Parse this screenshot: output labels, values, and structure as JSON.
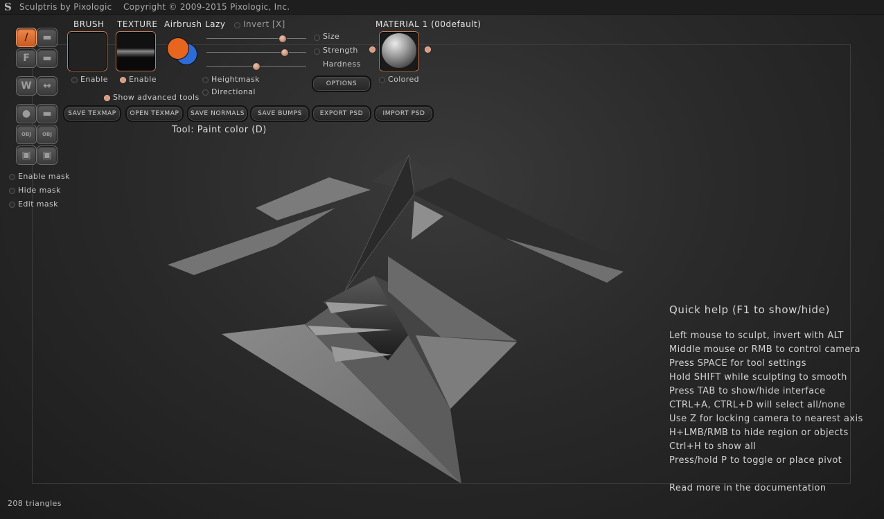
{
  "window": {
    "title": "Sculptris by Pixologic    Copyright © 2009-2015 Pixologic, Inc."
  },
  "palette": {
    "draw_glyph": "/",
    "flatten_glyph": "F",
    "pinch_glyph": "W",
    "symmetry_glyph": "↔",
    "obj_label": "OBJ"
  },
  "brush": {
    "header": "BRUSH",
    "enable_label": "Enable",
    "enabled": false
  },
  "texture": {
    "header": "TEXTURE",
    "enable_label": "Enable",
    "enabled": true
  },
  "airbrush": {
    "header": "Airbrush",
    "primary_color": "#e8651f",
    "secondary_color": "#2d6bd6"
  },
  "lazy": {
    "header": "Lazy"
  },
  "invert": {
    "label": "Invert [X]",
    "enabled": false
  },
  "sliders": [
    {
      "label": "Size",
      "value": 0.76
    },
    {
      "label": "Strength",
      "value": 0.78
    },
    {
      "label": "Hardness",
      "value": 0.49
    }
  ],
  "options": {
    "heightmask": "Heightmask",
    "directional": "Directional",
    "show_advanced": "Show advanced tools",
    "options_button": "OPTIONS"
  },
  "material": {
    "header": "MATERIAL 1 (00default)",
    "colored_label": "Colored"
  },
  "export_buttons": [
    "SAVE TEXMAP",
    "OPEN TEXMAP",
    "SAVE NORMALS",
    "SAVE BUMPS",
    "EXPORT PSD",
    "IMPORT PSD"
  ],
  "tool_status": "Tool: Paint color (D)",
  "mask": {
    "enable": "Enable mask",
    "hide": "Hide mask",
    "edit": "Edit mask"
  },
  "quick_help": {
    "title": "Quick help (F1 to show/hide)",
    "lines": [
      "Left mouse to sculpt, invert with ALT",
      "Middle mouse or RMB to control camera",
      "Press SPACE for tool settings",
      "Hold SHIFT while sculpting to smooth",
      "Press TAB to show/hide interface",
      "CTRL+A, CTRL+D will select all/none",
      "Use Z for locking camera to nearest axis",
      "H+LMB/RMB to hide region or objects",
      "Ctrl+H to show all",
      "Press/hold P to toggle or place pivot"
    ],
    "footer": "Read more in the documentation"
  },
  "status": {
    "triangles": "208 triangles"
  },
  "colors": {
    "accent": "#e8651f",
    "panel_border": "#c07a58"
  }
}
